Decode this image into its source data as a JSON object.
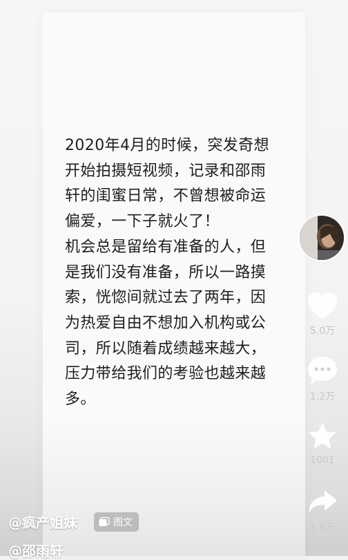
{
  "post": {
    "text": "2020年4月的时候，突发奇想\n开始拍摄短视频，记录和邵雨\n轩的闺蜜日常，不曾想被命运\n偏爱，一下子就火了！\n机会总是留给有准备的人，但\n是我们没有准备，所以一路摸\n索，恍惚间就过去了两年，因\n为热爱自由不想加入机构或公\n司，所以随着成绩越来越大，\n压力带给我们的考验也越来越\n多。"
  },
  "sidebar": {
    "like_count": "5.0万",
    "comment_count": "1.2万",
    "favorite_count": "1001",
    "share_count": "1.6万"
  },
  "bottom": {
    "author": "@疯产姐妹",
    "tag_label": "图文",
    "mention": "@邵雨轩"
  },
  "icons": {
    "like": "heart-icon",
    "comment": "comment-bubble-icon",
    "favorite": "star-icon",
    "share": "share-arrow-icon",
    "tag": "gallery-icon"
  },
  "colors": {
    "text": "#1e1e1e",
    "card": "#fafafa",
    "background": "#f2f2f2",
    "icon": "#ffffff",
    "count": "#c4c4c4"
  }
}
